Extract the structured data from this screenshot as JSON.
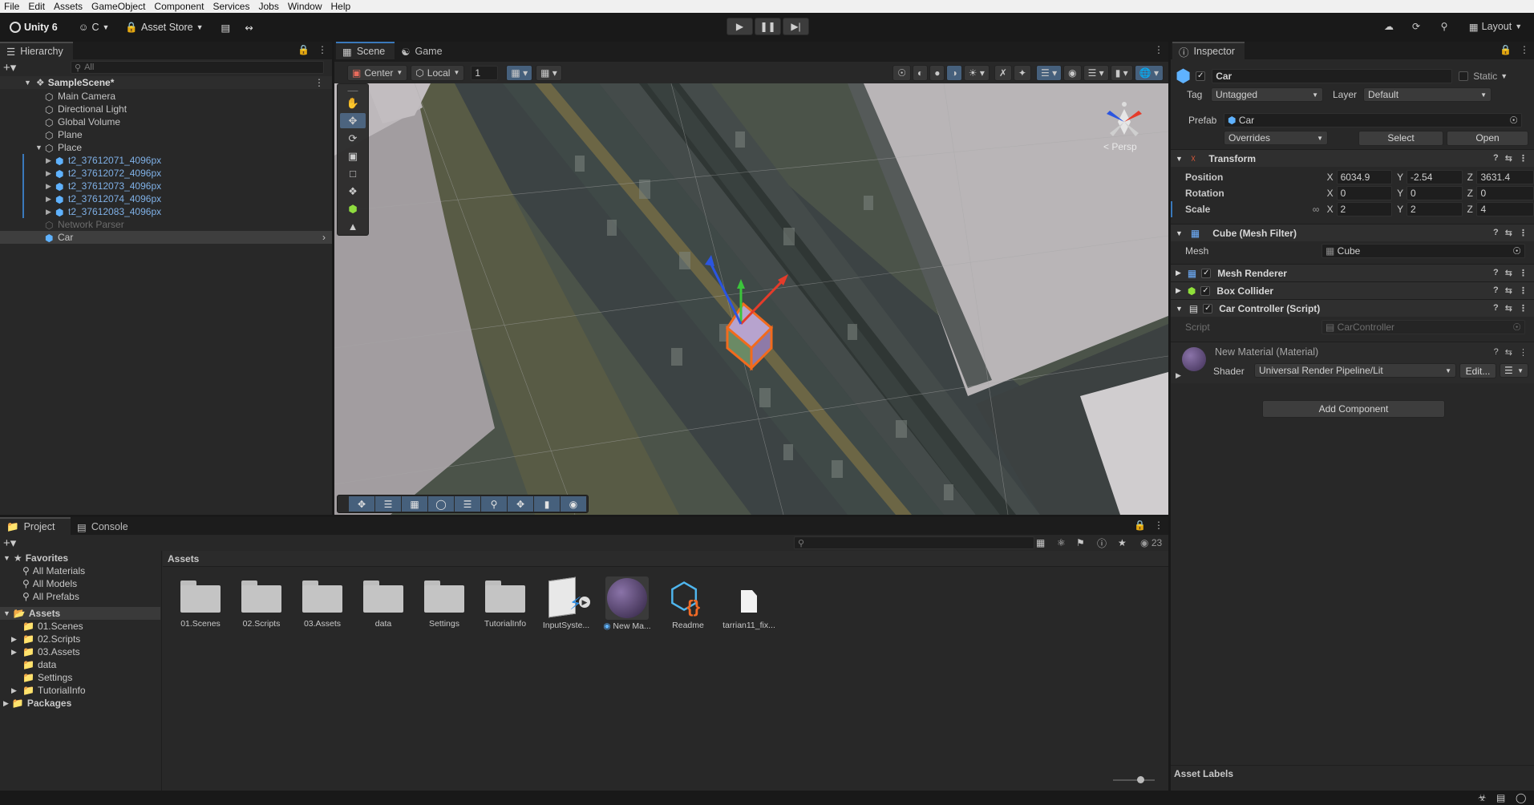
{
  "menu": [
    "File",
    "Edit",
    "Assets",
    "GameObject",
    "Component",
    "Services",
    "Jobs",
    "Window",
    "Help"
  ],
  "toolbar": {
    "unity_label": "Unity 6",
    "account_label": "C",
    "asset_store_label": "Asset Store",
    "layout_label": "Layout"
  },
  "hierarchy": {
    "tab": "Hierarchy",
    "search_placeholder": "All",
    "scene_name": "SampleScene*",
    "items": [
      {
        "label": "Main Camera"
      },
      {
        "label": "Directional Light"
      },
      {
        "label": "Global Volume"
      },
      {
        "label": "Plane"
      },
      {
        "label": "Place"
      },
      {
        "label": "t2_37612071_4096px"
      },
      {
        "label": "t2_37612072_4096px"
      },
      {
        "label": "t2_37612073_4096px"
      },
      {
        "label": "t2_37612074_4096px"
      },
      {
        "label": "t2_37612083_4096px"
      },
      {
        "label": "Network Parser"
      },
      {
        "label": "Car"
      }
    ]
  },
  "scene": {
    "tab_scene": "Scene",
    "tab_game": "Game",
    "pivot_label": "Center",
    "space_label": "Local",
    "grid_value": "1",
    "persp_label": "< Persp"
  },
  "inspector": {
    "tab": "Inspector",
    "object_name": "Car",
    "static_label": "Static",
    "tag_label": "Tag",
    "tag_value": "Untagged",
    "layer_label": "Layer",
    "layer_value": "Default",
    "prefab_label": "Prefab",
    "prefab_value": "Car",
    "overrides_label": "Overrides",
    "select_label": "Select",
    "open_label": "Open",
    "transform": {
      "title": "Transform",
      "position_label": "Position",
      "rotation_label": "Rotation",
      "scale_label": "Scale",
      "position": {
        "x": "6034.9",
        "y": "-2.54",
        "z": "3631.4"
      },
      "rotation": {
        "x": "0",
        "y": "0",
        "z": "0"
      },
      "scale": {
        "x": "2",
        "y": "2",
        "z": "4"
      }
    },
    "mesh_filter": {
      "title": "Cube (Mesh Filter)",
      "mesh_label": "Mesh",
      "mesh_value": "Cube"
    },
    "mesh_renderer_title": "Mesh Renderer",
    "box_collider_title": "Box Collider",
    "car_controller": {
      "title": "Car Controller (Script)",
      "script_label": "Script",
      "script_value": "CarController"
    },
    "material": {
      "title": "New Material (Material)",
      "shader_label": "Shader",
      "shader_value": "Universal Render Pipeline/Lit",
      "edit_label": "Edit..."
    },
    "add_component": "Add Component",
    "asset_labels": "Asset Labels"
  },
  "project": {
    "tab_project": "Project",
    "tab_console": "Console",
    "favorites": "Favorites",
    "fav_items": [
      "All Materials",
      "All Models",
      "All Prefabs"
    ],
    "assets_root": "Assets",
    "asset_folders": [
      "01.Scenes",
      "02.Scripts",
      "03.Assets",
      "data",
      "Settings",
      "TutorialInfo"
    ],
    "packages": "Packages",
    "breadcrumb": "Assets",
    "hidden_count": "23",
    "grid": [
      "01.Scenes",
      "02.Scripts",
      "03.Assets",
      "data",
      "Settings",
      "TutorialInfo",
      "InputSyste...",
      "New Ma...",
      "Readme",
      "tarrian11_fix..."
    ]
  },
  "colors": {
    "accent": "#3a79bb",
    "selection_orange": "#f26b1d",
    "panel": "#282828"
  }
}
